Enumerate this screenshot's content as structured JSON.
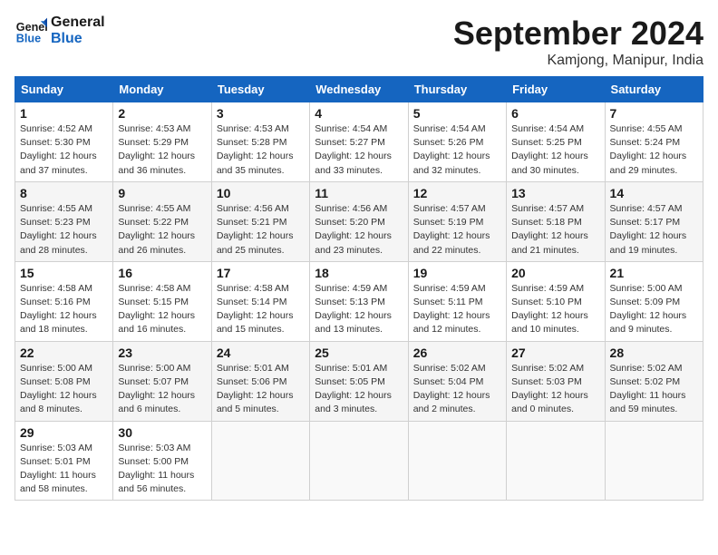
{
  "header": {
    "logo_line1": "General",
    "logo_line2": "Blue",
    "month": "September 2024",
    "location": "Kamjong, Manipur, India"
  },
  "weekdays": [
    "Sunday",
    "Monday",
    "Tuesday",
    "Wednesday",
    "Thursday",
    "Friday",
    "Saturday"
  ],
  "weeks": [
    [
      {
        "day": "1",
        "info": "Sunrise: 4:52 AM\nSunset: 5:30 PM\nDaylight: 12 hours\nand 37 minutes."
      },
      {
        "day": "2",
        "info": "Sunrise: 4:53 AM\nSunset: 5:29 PM\nDaylight: 12 hours\nand 36 minutes."
      },
      {
        "day": "3",
        "info": "Sunrise: 4:53 AM\nSunset: 5:28 PM\nDaylight: 12 hours\nand 35 minutes."
      },
      {
        "day": "4",
        "info": "Sunrise: 4:54 AM\nSunset: 5:27 PM\nDaylight: 12 hours\nand 33 minutes."
      },
      {
        "day": "5",
        "info": "Sunrise: 4:54 AM\nSunset: 5:26 PM\nDaylight: 12 hours\nand 32 minutes."
      },
      {
        "day": "6",
        "info": "Sunrise: 4:54 AM\nSunset: 5:25 PM\nDaylight: 12 hours\nand 30 minutes."
      },
      {
        "day": "7",
        "info": "Sunrise: 4:55 AM\nSunset: 5:24 PM\nDaylight: 12 hours\nand 29 minutes."
      }
    ],
    [
      {
        "day": "8",
        "info": "Sunrise: 4:55 AM\nSunset: 5:23 PM\nDaylight: 12 hours\nand 28 minutes."
      },
      {
        "day": "9",
        "info": "Sunrise: 4:55 AM\nSunset: 5:22 PM\nDaylight: 12 hours\nand 26 minutes."
      },
      {
        "day": "10",
        "info": "Sunrise: 4:56 AM\nSunset: 5:21 PM\nDaylight: 12 hours\nand 25 minutes."
      },
      {
        "day": "11",
        "info": "Sunrise: 4:56 AM\nSunset: 5:20 PM\nDaylight: 12 hours\nand 23 minutes."
      },
      {
        "day": "12",
        "info": "Sunrise: 4:57 AM\nSunset: 5:19 PM\nDaylight: 12 hours\nand 22 minutes."
      },
      {
        "day": "13",
        "info": "Sunrise: 4:57 AM\nSunset: 5:18 PM\nDaylight: 12 hours\nand 21 minutes."
      },
      {
        "day": "14",
        "info": "Sunrise: 4:57 AM\nSunset: 5:17 PM\nDaylight: 12 hours\nand 19 minutes."
      }
    ],
    [
      {
        "day": "15",
        "info": "Sunrise: 4:58 AM\nSunset: 5:16 PM\nDaylight: 12 hours\nand 18 minutes."
      },
      {
        "day": "16",
        "info": "Sunrise: 4:58 AM\nSunset: 5:15 PM\nDaylight: 12 hours\nand 16 minutes."
      },
      {
        "day": "17",
        "info": "Sunrise: 4:58 AM\nSunset: 5:14 PM\nDaylight: 12 hours\nand 15 minutes."
      },
      {
        "day": "18",
        "info": "Sunrise: 4:59 AM\nSunset: 5:13 PM\nDaylight: 12 hours\nand 13 minutes."
      },
      {
        "day": "19",
        "info": "Sunrise: 4:59 AM\nSunset: 5:11 PM\nDaylight: 12 hours\nand 12 minutes."
      },
      {
        "day": "20",
        "info": "Sunrise: 4:59 AM\nSunset: 5:10 PM\nDaylight: 12 hours\nand 10 minutes."
      },
      {
        "day": "21",
        "info": "Sunrise: 5:00 AM\nSunset: 5:09 PM\nDaylight: 12 hours\nand 9 minutes."
      }
    ],
    [
      {
        "day": "22",
        "info": "Sunrise: 5:00 AM\nSunset: 5:08 PM\nDaylight: 12 hours\nand 8 minutes."
      },
      {
        "day": "23",
        "info": "Sunrise: 5:00 AM\nSunset: 5:07 PM\nDaylight: 12 hours\nand 6 minutes."
      },
      {
        "day": "24",
        "info": "Sunrise: 5:01 AM\nSunset: 5:06 PM\nDaylight: 12 hours\nand 5 minutes."
      },
      {
        "day": "25",
        "info": "Sunrise: 5:01 AM\nSunset: 5:05 PM\nDaylight: 12 hours\nand 3 minutes."
      },
      {
        "day": "26",
        "info": "Sunrise: 5:02 AM\nSunset: 5:04 PM\nDaylight: 12 hours\nand 2 minutes."
      },
      {
        "day": "27",
        "info": "Sunrise: 5:02 AM\nSunset: 5:03 PM\nDaylight: 12 hours\nand 0 minutes."
      },
      {
        "day": "28",
        "info": "Sunrise: 5:02 AM\nSunset: 5:02 PM\nDaylight: 11 hours\nand 59 minutes."
      }
    ],
    [
      {
        "day": "29",
        "info": "Sunrise: 5:03 AM\nSunset: 5:01 PM\nDaylight: 11 hours\nand 58 minutes."
      },
      {
        "day": "30",
        "info": "Sunrise: 5:03 AM\nSunset: 5:00 PM\nDaylight: 11 hours\nand 56 minutes."
      },
      {
        "day": "",
        "info": ""
      },
      {
        "day": "",
        "info": ""
      },
      {
        "day": "",
        "info": ""
      },
      {
        "day": "",
        "info": ""
      },
      {
        "day": "",
        "info": ""
      }
    ]
  ]
}
